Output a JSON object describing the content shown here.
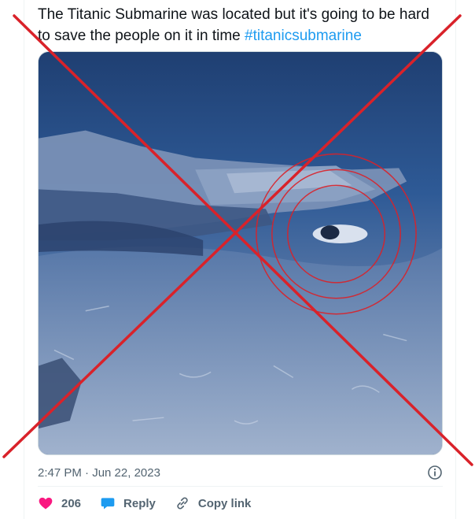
{
  "tweet": {
    "text": "The Titanic Submarine was located but it's going to be hard to save the people on it in time",
    "hashtag": "#titanicsubmarine",
    "timestamp": "2:47 PM · Jun 22, 2023"
  },
  "media": {
    "icon": "underwater-photo-of-titanic-wreck-with-red-circles-around-submarine"
  },
  "actions": {
    "like_count": "206",
    "reply_label": "Reply",
    "copy_link_label": "Copy link"
  },
  "overlay": {
    "icon": "red-x-mark",
    "color": "#d9222a"
  },
  "colors": {
    "like": "#f91880",
    "reply": "#1d9bf0",
    "hashtag": "#1d9bf0",
    "muted": "#536471"
  }
}
